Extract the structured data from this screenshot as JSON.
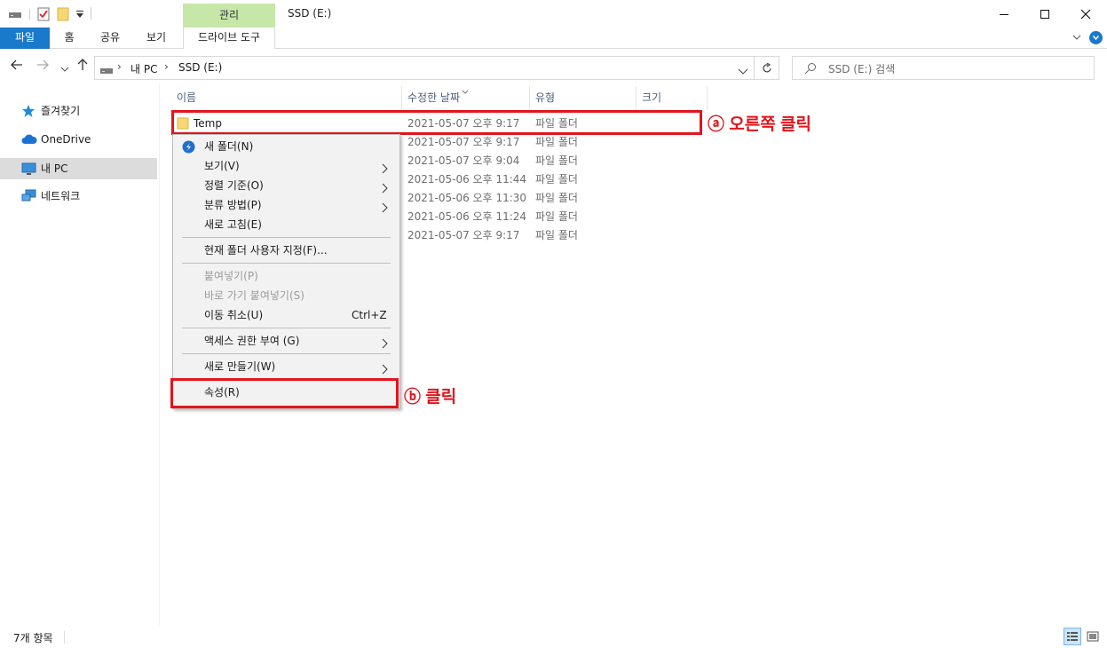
{
  "titlebar": {
    "title": "SSD (E:)",
    "context_tab_header": "관리",
    "minimize_icon": "minimize-icon",
    "maximize_icon": "maximize-icon",
    "close_icon": "close-icon"
  },
  "ribbon": {
    "tabs": [
      "파일",
      "홈",
      "공유",
      "보기"
    ],
    "context_tab": "드라이브 도구",
    "accent_color": "#1979ca",
    "context_color": "#c7e7a9"
  },
  "address": {
    "breadcrumb": [
      "내 PC",
      "SSD (E:)"
    ],
    "search_placeholder": "SSD (E:) 검색"
  },
  "navpane": {
    "items": [
      {
        "label": "즐겨찾기",
        "icon": "star-icon"
      },
      {
        "label": "OneDrive",
        "icon": "cloud-icon"
      },
      {
        "label": "내 PC",
        "icon": "computer-icon",
        "selected": true
      },
      {
        "label": "네트워크",
        "icon": "network-icon"
      }
    ]
  },
  "filelist": {
    "columns": [
      "이름",
      "수정한 날짜",
      "유형",
      "크기"
    ],
    "rows": [
      {
        "name": "Temp",
        "date": "2021-05-07 오후 9:17",
        "type": "파일 폴더"
      },
      {
        "name": "",
        "date": "2021-05-07 오후 9:17",
        "type": "파일 폴더"
      },
      {
        "name": "",
        "date": "2021-05-07 오후 9:04",
        "type": "파일 폴더"
      },
      {
        "name": "",
        "date": "2021-05-06 오후 11:44",
        "type": "파일 폴더"
      },
      {
        "name": "",
        "date": "2021-05-06 오후 11:30",
        "type": "파일 폴더"
      },
      {
        "name": "",
        "date": "2021-05-06 오후 11:24",
        "type": "파일 폴더"
      },
      {
        "name": "",
        "date": "2021-05-07 오후 9:17",
        "type": "파일 폴더"
      }
    ]
  },
  "context_menu": {
    "new_folder": "새 폴더(N)",
    "view": "보기(V)",
    "sort_by": "정렬 기준(O)",
    "group_by": "분류 방법(P)",
    "refresh": "새로 고침(E)",
    "customize": "현재 폴더 사용자 지정(F)...",
    "paste": "붙여넣기(P)",
    "paste_shortcut": "바로 가기 붙여넣기(S)",
    "undo_move": "이동 취소(U)",
    "undo_shortcut": "Ctrl+Z",
    "give_access": "액세스 권한 부여 (G)",
    "new": "새로 만들기(W)",
    "properties": "속성(R)"
  },
  "annotations": {
    "a": "ⓐ 오른쪽 클릭",
    "b": "ⓑ 클릭",
    "color": "#e3141c"
  },
  "statusbar": {
    "item_count": "7개 항목"
  }
}
